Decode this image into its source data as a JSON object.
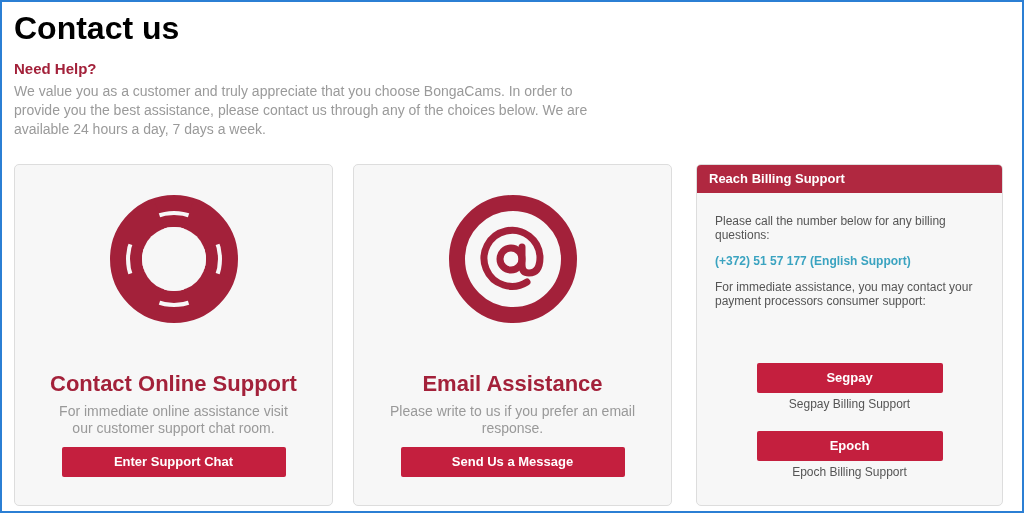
{
  "heading": "Contact us",
  "subheading": "Need Help?",
  "intro": "We value you as a customer and truly appreciate that you choose BongaCams. In order to provide you the best assistance, please contact us through any of the choices below. We are available 24 hours a day, 7 days a week.",
  "cards": [
    {
      "kind": "lifebuoy",
      "title": "Contact Online Support",
      "description": "For immediate online assistance visit our customer support chat room.",
      "button": "Enter Support Chat"
    },
    {
      "kind": "email",
      "title": "Email Assistance",
      "description": "Please write to us if you prefer an email response.",
      "button": "Send Us a Message"
    }
  ],
  "billing": {
    "title": "Reach Billing Support",
    "text": "Please call the number below for any billing questions:",
    "phone": "(+372) 51 57 177 (English Support)",
    "note": "For immediate assistance, you may contact your payment processors consumer support:",
    "processors": [
      {
        "button": "Segpay",
        "caption": "Segpay Billing Support"
      },
      {
        "button": "Epoch",
        "caption": "Epoch Billing Support"
      }
    ]
  }
}
